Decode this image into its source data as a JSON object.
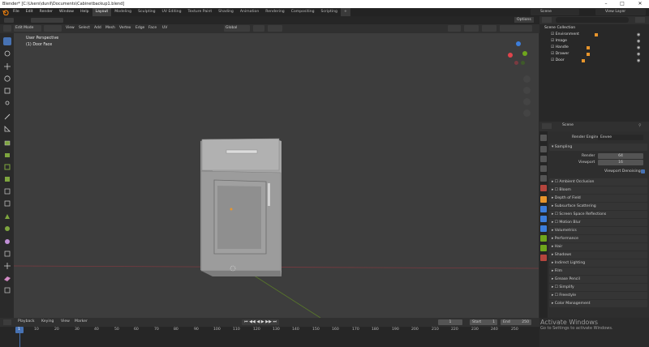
{
  "window": {
    "title": "Blender* [C:\\Users\\dunil\\Documents\\Cabinetbackup1.blend]",
    "minimize": "–",
    "maximize": "□",
    "close": "✕"
  },
  "menubar": [
    "File",
    "Edit",
    "Render",
    "Window",
    "Help"
  ],
  "workspaces": [
    "Layout",
    "Modeling",
    "Sculpting",
    "UV Editing",
    "Texture Paint",
    "Shading",
    "Animation",
    "Rendering",
    "Compositing",
    "Scripting"
  ],
  "active_workspace": "Layout",
  "scene_label": "Scene",
  "view_layer_label": "View Layer",
  "viewport_header": {
    "mode": "Edit Mode",
    "menus": [
      "View",
      "Select",
      "Add",
      "Mesh",
      "Vertex",
      "Edge",
      "Face",
      "UV"
    ],
    "transform_orientation": "Global",
    "options": "Options"
  },
  "viewport_overlay": {
    "view_name": "User Perspective",
    "object_label": "(1) Door Face"
  },
  "gizmo_axes": {
    "x": "X",
    "y": "Y",
    "z": "Z"
  },
  "outliner": {
    "title": "Scene Collection",
    "items": [
      "Environment",
      "Image",
      "Handle",
      "Drawer",
      "Door"
    ]
  },
  "properties": {
    "scene": "Scene",
    "render_engine_label": "Render Engine",
    "render_engine_value": "Eevee",
    "sampling_header": "Sampling",
    "render_label": "Render",
    "render_value": "64",
    "viewport_label": "Viewport",
    "viewport_value": "16",
    "viewport_denoising": "Viewport Denoising",
    "panels": [
      "Ambient Occlusion",
      "Bloom",
      "Depth of Field",
      "Subsurface Scattering",
      "Screen Space Reflections",
      "Motion Blur",
      "Volumetrics",
      "Performance",
      "Hair",
      "Shadows",
      "Indirect Lighting",
      "Film",
      "Grease Pencil",
      "Simplify",
      "Freestyle",
      "Color Management"
    ]
  },
  "timeline": {
    "menus": [
      "Playback",
      "Keying",
      "View",
      "Marker"
    ],
    "current_frame": "1",
    "start_label": "Start",
    "start_value": "1",
    "end_label": "End",
    "end_value": "250",
    "ticks": [
      "1",
      "10",
      "20",
      "30",
      "40",
      "50",
      "60",
      "70",
      "80",
      "90",
      "100",
      "110",
      "120",
      "130",
      "140",
      "150",
      "160",
      "170",
      "180",
      "190",
      "200",
      "210",
      "220",
      "230",
      "240",
      "250"
    ]
  },
  "watermark": {
    "line1": "Activate Windows",
    "line2": "Go to Settings to activate Windows."
  },
  "colors": {
    "accent": "#4772b3",
    "x_axis": "#e0444c",
    "y_axis": "#6fa61c",
    "z_axis": "#3d7edb"
  }
}
